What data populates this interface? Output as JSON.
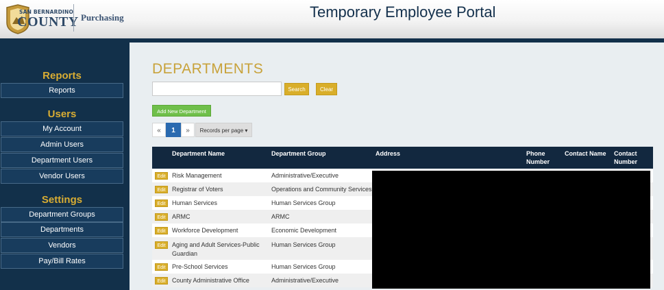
{
  "header": {
    "logo_top_text": "SAN BERNARDINO",
    "logo_county_text": "COUNTY",
    "department_label": "Purchasing",
    "app_title": "Temporary Employee Portal"
  },
  "sidebar": {
    "sections": [
      {
        "heading": "Reports",
        "items": [
          "Reports"
        ]
      },
      {
        "heading": "Users",
        "items": [
          "My Account",
          "Admin Users",
          "Department Users",
          "Vendor Users"
        ]
      },
      {
        "heading": "Settings",
        "items": [
          "Department Groups",
          "Departments",
          "Vendors",
          "Pay/Bill Rates"
        ]
      }
    ]
  },
  "main": {
    "page_title": "DEPARTMENTS",
    "search": {
      "value": "",
      "placeholder": ""
    },
    "search_button": "Search",
    "clear_button": "Clear",
    "add_button": "Add New Department",
    "pager": {
      "prev": "«",
      "current": "1",
      "next": "»",
      "per_page_label": "Records per page ▾"
    },
    "table": {
      "columns": [
        "Department Name",
        "Department Group",
        "Address",
        "Phone Number",
        "Contact Name",
        "Contact Number"
      ],
      "edit_label": "Edit",
      "rows": [
        {
          "name": "Risk Management",
          "group": "Administrative/Executive"
        },
        {
          "name": "Registrar of Voters",
          "group": "Operations and Community Services"
        },
        {
          "name": "Human Services",
          "group": "Human Services Group"
        },
        {
          "name": "ARMC",
          "group": "ARMC"
        },
        {
          "name": "Workforce Development",
          "group": "Economic Development"
        },
        {
          "name": "Aging and Adult Services-Public Guardian",
          "group": "Human Services Group"
        },
        {
          "name": "Pre-School Services",
          "group": "Human Services Group"
        },
        {
          "name": "County Administrative Office",
          "group": "Administrative/Executive"
        }
      ]
    }
  },
  "colors": {
    "navy": "#12304a",
    "gold": "#d9ae2a",
    "green": "#6fbf4a",
    "page_bg": "#e9eef1",
    "pager_active": "#2a6ab0"
  }
}
